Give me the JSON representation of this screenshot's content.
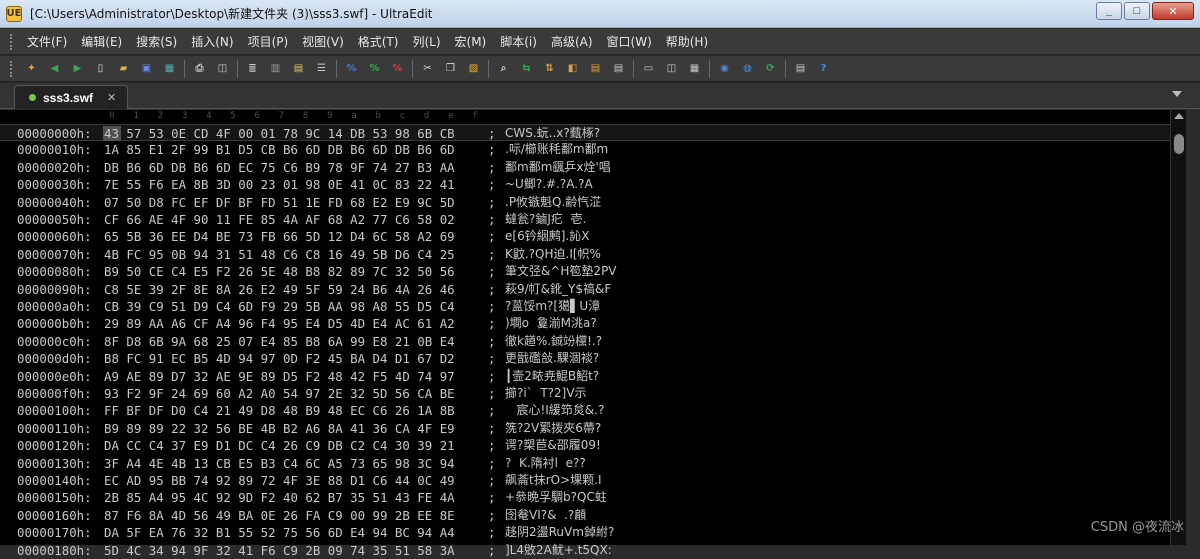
{
  "window": {
    "title": "[C:\\Users\\Administrator\\Desktop\\新建文件夹 (3)\\sss3.swf] - UltraEdit",
    "app_icon_label": "UE",
    "minimize_label": "_",
    "maximize_label": "□",
    "close_label": "✕"
  },
  "menu": {
    "items": [
      {
        "label": "文件(F)"
      },
      {
        "label": "编辑(E)"
      },
      {
        "label": "搜索(S)"
      },
      {
        "label": "插入(N)"
      },
      {
        "label": "项目(P)"
      },
      {
        "label": "视图(V)"
      },
      {
        "label": "格式(T)"
      },
      {
        "label": "列(L)"
      },
      {
        "label": "宏(M)"
      },
      {
        "label": "脚本(i)"
      },
      {
        "label": "高级(A)"
      },
      {
        "label": "窗口(W)"
      },
      {
        "label": "帮助(H)"
      }
    ]
  },
  "toolbar": {
    "buttons": [
      {
        "icon": "new-file-icon",
        "glyph": "✦",
        "color": "#e8a33a"
      },
      {
        "icon": "back-arrow-icon",
        "glyph": "◀",
        "color": "#3aa35a"
      },
      {
        "icon": "forward-arrow-icon",
        "glyph": "▶",
        "color": "#3aa35a"
      },
      {
        "icon": "blank-page-icon",
        "glyph": "▯",
        "color": "#d8d8d8"
      },
      {
        "icon": "open-folder-icon",
        "glyph": "▰",
        "color": "#e0b040"
      },
      {
        "icon": "save-icon",
        "glyph": "▣",
        "color": "#6a8ad8"
      },
      {
        "icon": "save-all-icon",
        "glyph": "▦",
        "color": "#4ab0b0"
      },
      {
        "sep": true
      },
      {
        "icon": "print-icon",
        "glyph": "⎙",
        "color": "#c8c8c8"
      },
      {
        "icon": "print-preview-icon",
        "glyph": "◫",
        "color": "#c8c8c8"
      },
      {
        "sep": true
      },
      {
        "icon": "properties-icon",
        "glyph": "≣",
        "color": "#c8c8c8"
      },
      {
        "icon": "hex-mode-icon",
        "glyph": "▥",
        "color": "#9a9a9a"
      },
      {
        "icon": "column-mode-icon",
        "glyph": "▤",
        "color": "#e0c860"
      },
      {
        "icon": "word-wrap-icon",
        "glyph": "☰",
        "color": "#c8c8c8"
      },
      {
        "sep": true
      },
      {
        "icon": "spell-check-icon",
        "glyph": "%",
        "color": "#4a7ad8"
      },
      {
        "icon": "macro-play-icon",
        "glyph": "%",
        "color": "#3aa35a"
      },
      {
        "icon": "macro-record-icon",
        "glyph": "%",
        "color": "#d83a3a"
      },
      {
        "sep": true
      },
      {
        "icon": "cut-icon",
        "glyph": "✂",
        "color": "#d8d8d8"
      },
      {
        "icon": "copy-icon",
        "glyph": "❐",
        "color": "#d8d8d8"
      },
      {
        "icon": "paste-icon",
        "glyph": "▨",
        "color": "#e0b040"
      },
      {
        "sep": true
      },
      {
        "icon": "find-icon",
        "glyph": "⌕",
        "color": "#c8c8c8"
      },
      {
        "icon": "replace-icon",
        "glyph": "⇆",
        "color": "#3aa35a"
      },
      {
        "icon": "find-in-files-icon",
        "glyph": "⇅",
        "color": "#d8a040"
      },
      {
        "icon": "bookmark-icon",
        "glyph": "◧",
        "color": "#e0a040"
      },
      {
        "icon": "file-compare-icon",
        "glyph": "▤",
        "color": "#e0a040"
      },
      {
        "icon": "function-list-icon",
        "glyph": "▤",
        "color": "#c8c8c8"
      },
      {
        "sep": true
      },
      {
        "icon": "split-horizontal-icon",
        "glyph": "▭",
        "color": "#c8c8c8"
      },
      {
        "icon": "split-vertical-icon",
        "glyph": "◫",
        "color": "#c8c8c8"
      },
      {
        "icon": "window-tile-icon",
        "glyph": "▦",
        "color": "#c8c8c8"
      },
      {
        "sep": true
      },
      {
        "icon": "browser-icon",
        "glyph": "◉",
        "color": "#4a8ad8"
      },
      {
        "icon": "ftp-icon",
        "glyph": "◍",
        "color": "#4a8ad8"
      },
      {
        "icon": "refresh-icon",
        "glyph": "⟳",
        "color": "#3aa35a"
      },
      {
        "sep": true
      },
      {
        "icon": "list-view-icon",
        "glyph": "▤",
        "color": "#c8c8c8"
      },
      {
        "icon": "help-icon",
        "glyph": "?",
        "color": "#4a8ad8"
      }
    ]
  },
  "tabs": [
    {
      "label": "sss3.swf",
      "close": "✕"
    }
  ],
  "hex": {
    "ruler": [
      "0",
      "1",
      "2",
      "3",
      "4",
      "5",
      "6",
      "7",
      "8",
      "9",
      "a",
      "b",
      "c",
      "d",
      "e",
      "f"
    ],
    "separator": ";",
    "rows": [
      {
        "offset": "00000000h:",
        "hex": "43 57 53 0E CD 4F 00 01 78 9C 14 DB 53 98 6B CB",
        "ascii": "CWS.蚖..x?薽椓?"
      },
      {
        "offset": "00000010h:",
        "hex": "1A 85 E1 2F 99 B1 D5 CB B6 6D DB B6 6D DB B6 6D",
        "ascii": ".呩/櫛账秏鄱m鄱m"
      },
      {
        "offset": "00000020h:",
        "hex": "DB B6 6D DB B6 6D EC 75 C6 B9 78 9F 74 27 B3 AA",
        "ascii": "鄱m鄱m颻乒x烇'唱"
      },
      {
        "offset": "00000030h:",
        "hex": "7E 55 F6 EA 8B 3D 00 23 01 98 0E 41 0C 83 22 41",
        "ascii": "~U鲫?.#.?A.?A"
      },
      {
        "offset": "00000040h:",
        "hex": "07 50 D8 FC EF DF BF FD 51 1E FD 68 E2 E9 9C 5D",
        "ascii": ".P攸镞魁Q.齢忾淽"
      },
      {
        "offset": "00000050h:",
        "hex": "CF 66 AE 4F 90 11 FE 85 4A AF 68 A2 77 C6 58 02",
        "ascii": "蟽瓮?鏀J疕  壱."
      },
      {
        "offset": "00000060h:",
        "hex": "65 5B 36 EE D4 BE 73 FB 66 5D 12 D4 6C 58 A2 69",
        "ascii": "e[6钤絪鹒].訫X"
      },
      {
        "offset": "00000070h:",
        "hex": "4B FC 95 0B 94 31 51 48 C6 C8 16 49 5B D6 C4 25",
        "ascii": "K鼤.?QH迫.I[帜%"
      },
      {
        "offset": "00000080h:",
        "hex": "B9 50 CE C4 E5 F2 26 5E 48 B8 82 89 7C 32 50 56",
        "ascii": "筆文弪&^H笣墊2PV"
      },
      {
        "offset": "00000090h:",
        "hex": "C8 5E 39 2F 8E 8A 26 E2 49 5F 59 24 B6 4A 26 46",
        "ascii": "萩9/帄&鈋_Y$禞&F"
      },
      {
        "offset": "000000a0h:",
        "hex": "CB 39 C9 51 D9 C4 6D F9 29 5B AA 98 A8 55 D5 C4",
        "ascii": "?蒕馁m?[獦▌U漳"
      },
      {
        "offset": "000000b0h:",
        "hex": "29 89 AA A6 CF A4 96 F4 95 E4 D5 4D E4 AC 61 A2",
        "ascii": ")墹o  敻湔M洮a?"
      },
      {
        "offset": "000000c0h:",
        "hex": "8F D8 6B 9A 68 25 07 E4 85 B8 6A 99 E8 21 0B E4",
        "ascii": "徹k趥%.鋮竕欓!.?"
      },
      {
        "offset": "000000d0h:",
        "hex": "B8 FC 91 EC B5 4D 94 97 0D F2 45 BA D4 D1 67 D2",
        "ascii": "更戩礛敆.騍涸裧?"
      },
      {
        "offset": "000000e0h:",
        "hex": "A9 AE 89 D7 32 AE 9E 89 D5 F2 48 42 F5 4D 74 97",
        "ascii": "┃壸2畩尭鯤B鮉t?"
      },
      {
        "offset": "000000f0h:",
        "hex": "93 F2 9F 24 69 60 A2 A0 54 97 2E 32 5D 56 CA BE",
        "ascii": "擳?i`  T?2]V示"
      },
      {
        "offset": "00000100h:",
        "hex": "FF BF DF D0 C4 21 49 D8 48 B9 48 EC C6 26 1A 8B",
        "ascii": "   宸心!I緩笻炱&.?"
      },
      {
        "offset": "00000110h:",
        "hex": "B9 89 89 22 32 56 BE 4B B2 A6 8A 41 36 CA 4F E9",
        "ascii": "箲?2V綤拨夾6蔕?"
      },
      {
        "offset": "00000120h:",
        "hex": "DA CC C4 37 E9 D1 DC C4 26 C9 DB C2 C4 30 39 21",
        "ascii": "谔?槊苣&邵履09!"
      },
      {
        "offset": "00000130h:",
        "hex": "3F A4 4E 4B 13 CB E5 B3 C4 6C A5 73 65 98 3C 94",
        "ascii": "?  K.隋衬l  e??"
      },
      {
        "offset": "00000140h:",
        "hex": "EC AD 95 BB 74 92 89 72 4F 3E 88 D1 C6 44 0C 49",
        "ascii": "飙菕t抺rO>堁颗.I"
      },
      {
        "offset": "00000150h:",
        "hex": "2B 85 A4 95 4C 92 9D F2 40 62 B7 35 51 43 FE 4A",
        "ascii": "+叅晩孚騆b?QC蛀"
      },
      {
        "offset": "00000160h:",
        "hex": "87 F6 8A 4D 56 49 BA 0E 26 FA C9 00 99 2B EE 8E",
        "ascii": "囹奙VI?&  .?顅"
      },
      {
        "offset": "00000170h:",
        "hex": "DA 5F EA 76 32 B1 55 52 75 56 6D E4 94 BC 94 A4",
        "ascii": "趍阴2盪RuVm鋽紨?"
      },
      {
        "offset": "00000180h:",
        "hex": "5D 4C 34 94 9F 32 41 F6 C9 2B 09 74 35 51 58 3A",
        "ascii": "]L4敓2A鱿+.t5QX:"
      }
    ]
  },
  "watermark": "CSDN @夜流冰"
}
